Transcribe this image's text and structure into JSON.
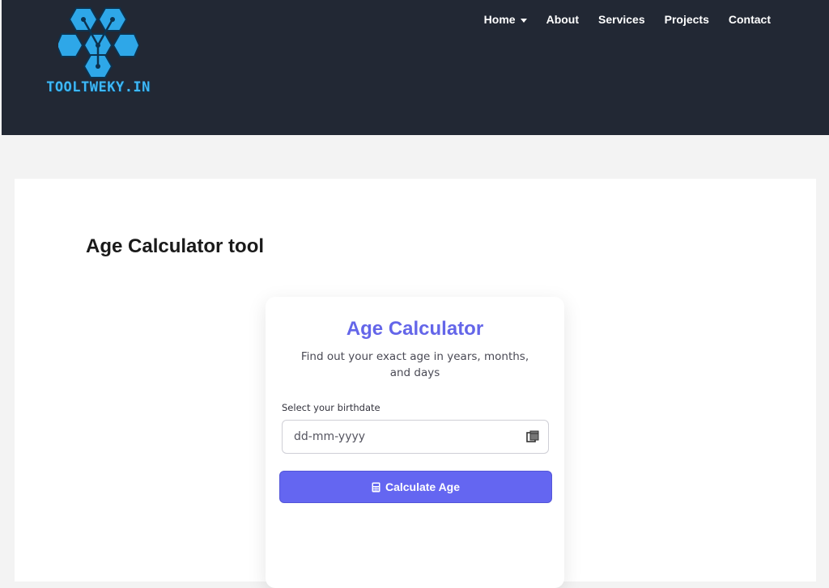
{
  "header": {
    "logo_text": "TOOLTWEKY.IN",
    "brand_color": "#3fb7f5",
    "background": "#222834"
  },
  "nav": {
    "items": [
      {
        "label": "Home",
        "has_dropdown": true
      },
      {
        "label": "About"
      },
      {
        "label": "Services"
      },
      {
        "label": "Projects"
      },
      {
        "label": "Contact"
      }
    ]
  },
  "page": {
    "title": "Age Calculator tool"
  },
  "calculator": {
    "title": "Age Calculator",
    "subtitle": "Find out your exact age in years, months, and days",
    "field_label": "Select your birthdate",
    "date_placeholder": "dd-mm-yyyy",
    "date_icon": "calendar-icon",
    "button_label": "Calculate Age",
    "button_icon": "calculator-icon",
    "accent_color": "#6466f1"
  }
}
